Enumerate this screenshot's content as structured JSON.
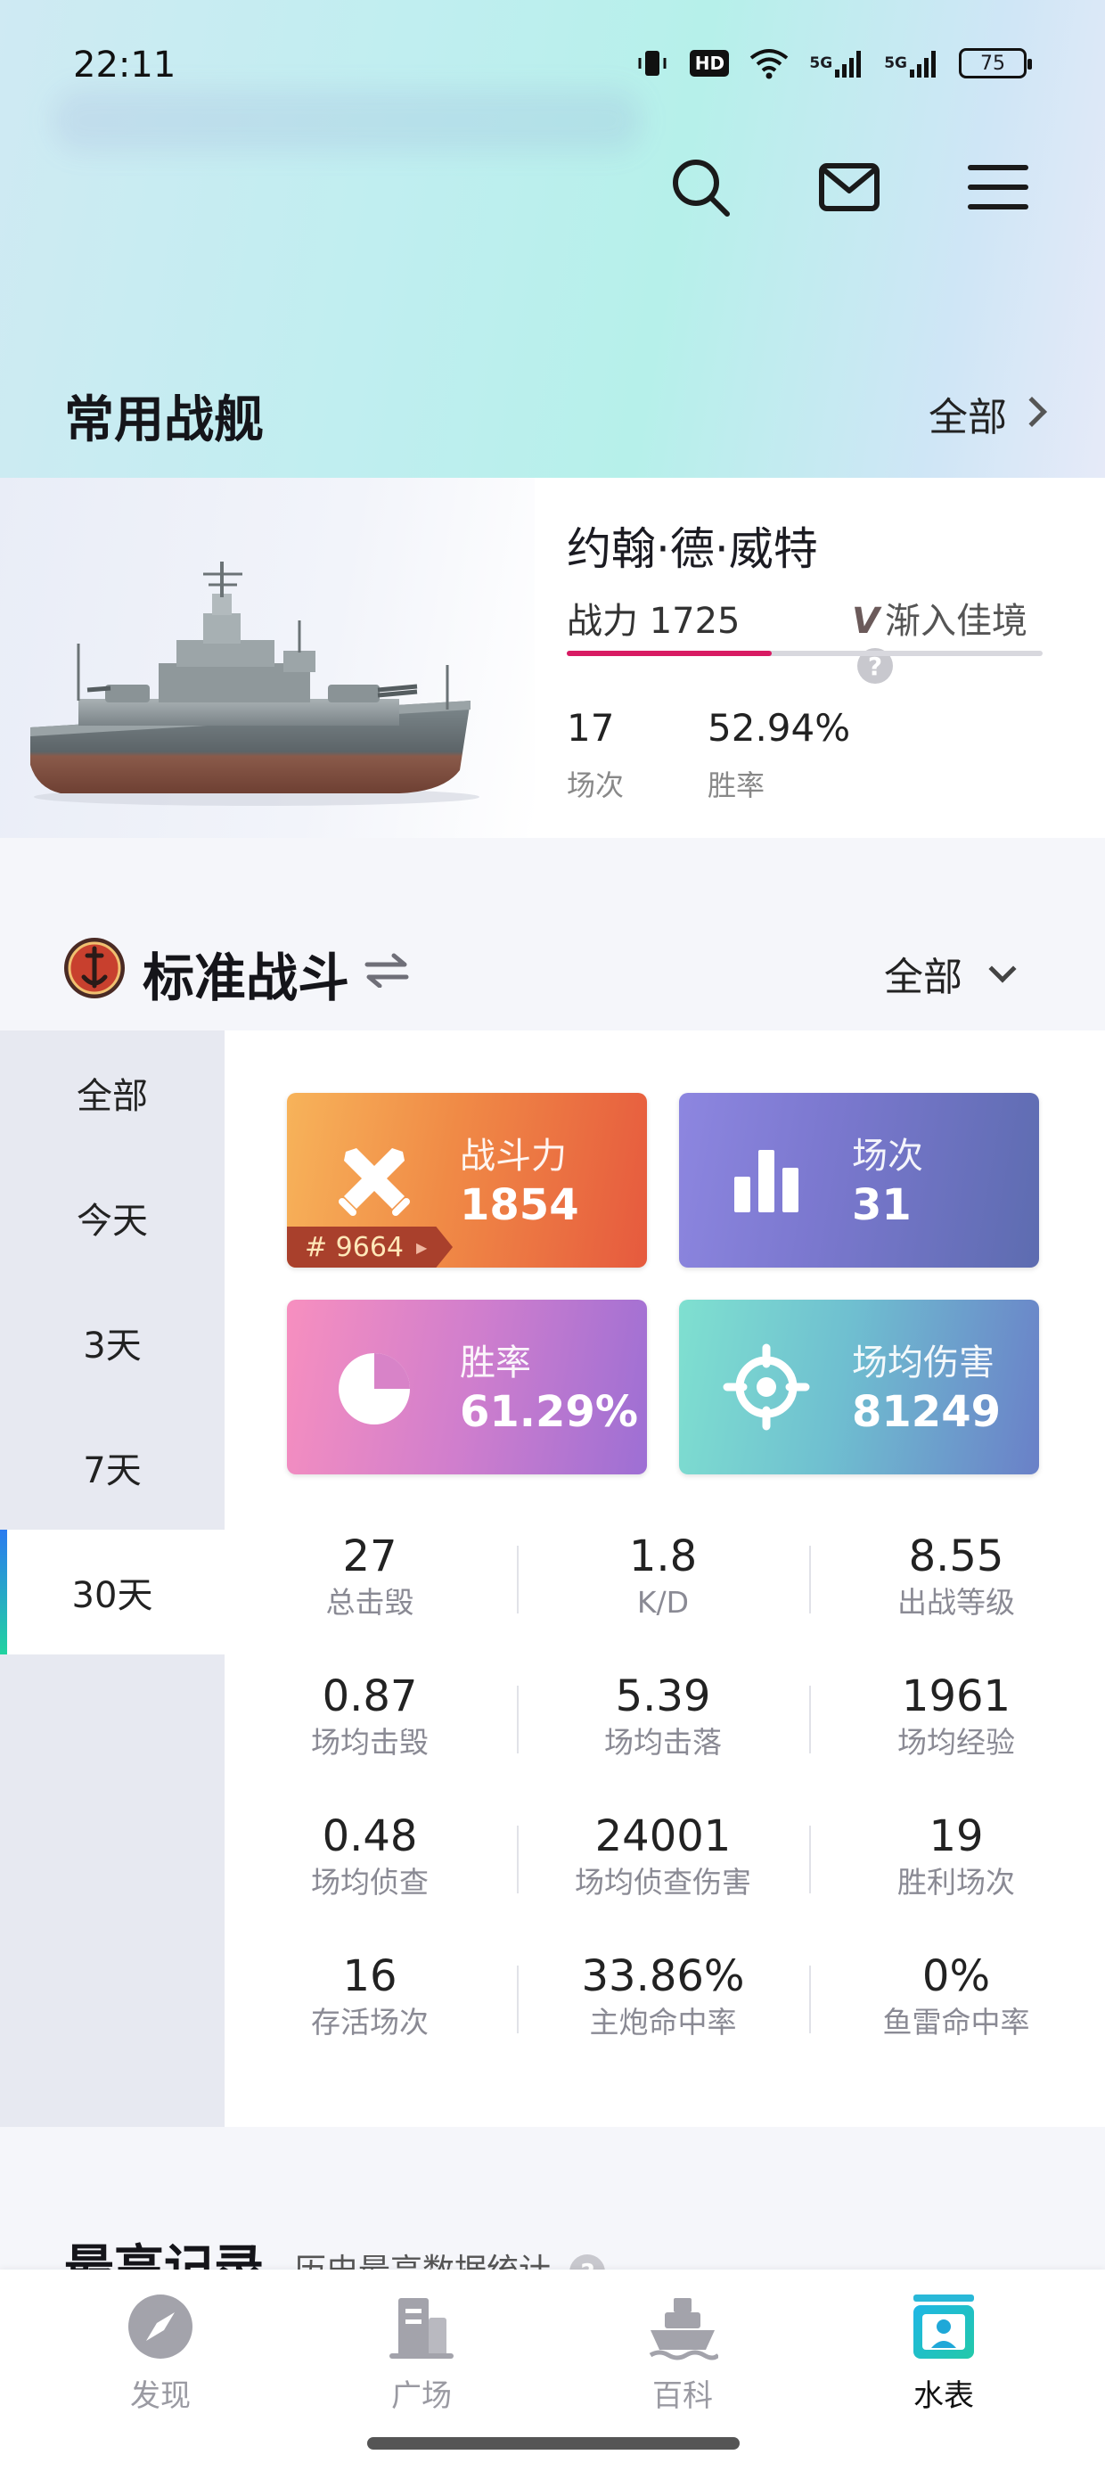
{
  "status_bar": {
    "time": "22:11",
    "hd_label": "HD",
    "signal_1_label": "5G",
    "signal_2_label": "5G",
    "battery": "75"
  },
  "header_icons": [
    "search-icon",
    "mail-icon",
    "menu-icon"
  ],
  "frequent_ships": {
    "title": "常用战舰",
    "more_label": "全部"
  },
  "ship_card": {
    "name": "约翰·德·威特",
    "power_label": "战力 1725",
    "status_label": "渐入佳境",
    "status_badge": "V",
    "help_symbol": "?",
    "progress_fraction": 0.43,
    "battles_value": "17",
    "battles_label": "场次",
    "winrate_value": "52.94%",
    "winrate_label": "胜率"
  },
  "battle_section": {
    "title": "标准战斗",
    "filter_label": "全部"
  },
  "periods": [
    {
      "label": "全部"
    },
    {
      "label": "今天"
    },
    {
      "label": "3天"
    },
    {
      "label": "7天"
    },
    {
      "label": "30天",
      "active": true
    }
  ],
  "stat_cards": {
    "power": {
      "label": "战斗力",
      "value": "1854",
      "rank": "# 9664"
    },
    "count": {
      "label": "场次",
      "value": "31"
    },
    "winrate": {
      "label": "胜率",
      "value": "61.29%",
      "fraction": 0.6129
    },
    "damage": {
      "label": "场均伤害",
      "value": "81249"
    }
  },
  "stats_grid": [
    [
      {
        "value": "27",
        "label": "总击毁"
      },
      {
        "value": "1.8",
        "label": "K/D"
      },
      {
        "value": "8.55",
        "label": "出战等级"
      }
    ],
    [
      {
        "value": "0.87",
        "label": "场均击毁"
      },
      {
        "value": "5.39",
        "label": "场均击落"
      },
      {
        "value": "1961",
        "label": "场均经验"
      }
    ],
    [
      {
        "value": "0.48",
        "label": "场均侦查"
      },
      {
        "value": "24001",
        "label": "场均侦查伤害"
      },
      {
        "value": "19",
        "label": "胜利场次"
      }
    ],
    [
      {
        "value": "16",
        "label": "存活场次"
      },
      {
        "value": "33.86%",
        "label": "主炮命中率"
      },
      {
        "value": "0%",
        "label": "鱼雷命中率"
      }
    ]
  ],
  "records": {
    "title": "最高记录",
    "subtitle": "历史最高数据统计",
    "help_symbol": "?"
  },
  "bottom_nav": [
    {
      "label": "发现",
      "icon": "compass-icon"
    },
    {
      "label": "广场",
      "icon": "building-icon"
    },
    {
      "label": "百科",
      "icon": "ship-icon"
    },
    {
      "label": "水表",
      "icon": "profile-card-icon",
      "active": true
    }
  ],
  "colors": {
    "accent_pink": "#d81b63",
    "active_tab_gradient": [
      "#2b7bf0",
      "#22d3a0"
    ],
    "rank_tag": "#a9402c"
  }
}
